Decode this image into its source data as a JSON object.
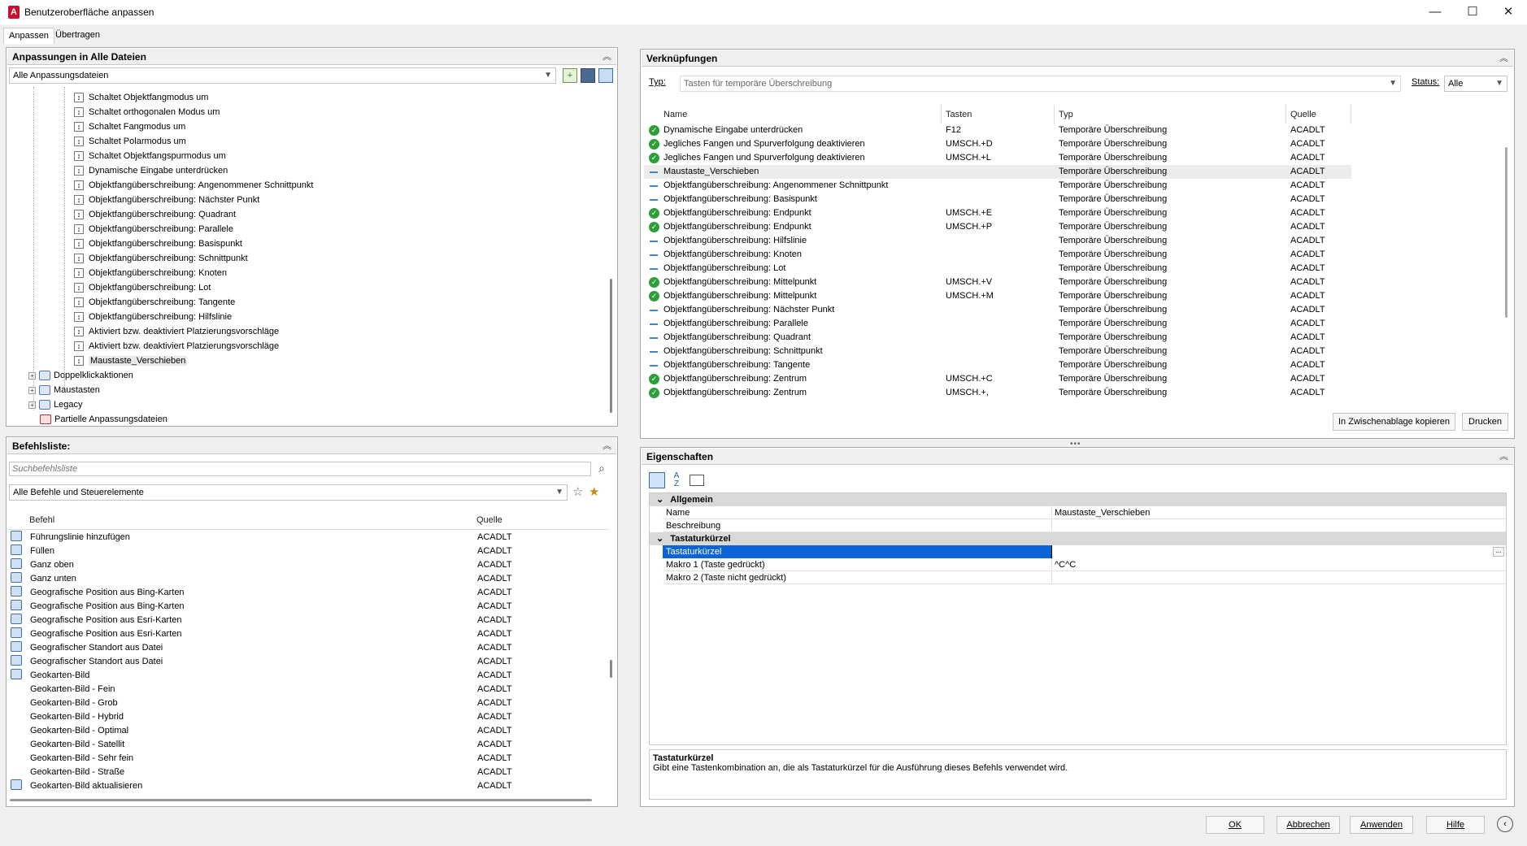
{
  "window": {
    "title": "Benutzeroberfläche anpassen",
    "app_icon": "A",
    "minimize": "—",
    "maximize": "☐",
    "close": "✕"
  },
  "tabs": [
    "Anpassen",
    "Übertragen"
  ],
  "customizations": {
    "title": "Anpassungen in Alle Dateien",
    "file_filter": "Alle Anpassungsdateien",
    "tree": [
      "Schaltet Objektfangmodus um",
      "Schaltet orthogonalen Modus um",
      "Schaltet Fangmodus um",
      "Schaltet Polarmodus um",
      "Schaltet Objektfangspurmodus um",
      "Dynamische Eingabe unterdrücken",
      "Objektfangüberschreibung: Angenommener Schnittpunkt",
      "Objektfangüberschreibung: Nächster Punkt",
      "Objektfangüberschreibung: Quadrant",
      "Objektfangüberschreibung: Parallele",
      "Objektfangüberschreibung: Basispunkt",
      "Objektfangüberschreibung: Schnittpunkt",
      "Objektfangüberschreibung: Knoten",
      "Objektfangüberschreibung: Lot",
      "Objektfangüberschreibung: Tangente",
      "Objektfangüberschreibung: Hilfslinie",
      "Aktiviert bzw. deaktiviert Platzierungsvorschläge",
      "Aktiviert bzw. deaktiviert Platzierungsvorschläge",
      "Maustaste_Verschieben"
    ],
    "folders": [
      "Doppelklickaktionen",
      "Maustasten",
      "Legacy",
      "Partielle Anpassungsdateien"
    ]
  },
  "commands": {
    "title": "Befehlsliste:",
    "search_placeholder": "Suchbefehlsliste",
    "filter": "Alle Befehle und Steuerelemente",
    "col_command": "Befehl",
    "col_source": "Quelle",
    "rows": [
      [
        "Führungslinie hinzufügen",
        "ACADLT"
      ],
      [
        "Füllen",
        "ACADLT"
      ],
      [
        "Ganz oben",
        "ACADLT"
      ],
      [
        "Ganz unten",
        "ACADLT"
      ],
      [
        "Geografische Position aus Bing-Karten",
        "ACADLT"
      ],
      [
        "Geografische Position aus Bing-Karten",
        "ACADLT"
      ],
      [
        "Geografische Position aus Esri-Karten",
        "ACADLT"
      ],
      [
        "Geografische Position aus Esri-Karten",
        "ACADLT"
      ],
      [
        "Geografischer Standort aus Datei",
        "ACADLT"
      ],
      [
        "Geografischer Standort aus Datei",
        "ACADLT"
      ],
      [
        "Geokarten-Bild",
        "ACADLT"
      ],
      [
        "Geokarten-Bild - Fein",
        "ACADLT"
      ],
      [
        "Geokarten-Bild - Grob",
        "ACADLT"
      ],
      [
        "Geokarten-Bild - Hybrid",
        "ACADLT"
      ],
      [
        "Geokarten-Bild - Optimal",
        "ACADLT"
      ],
      [
        "Geokarten-Bild - Satellit",
        "ACADLT"
      ],
      [
        "Geokarten-Bild - Sehr fein",
        "ACADLT"
      ],
      [
        "Geokarten-Bild - Straße",
        "ACADLT"
      ],
      [
        "Geokarten-Bild aktualisieren",
        "ACADLT"
      ]
    ]
  },
  "shortcuts": {
    "title": "Verknüpfungen",
    "type_label": "Typ:",
    "type_value": "Tasten für temporäre Überschreibung",
    "status_label": "Status:",
    "status_value": "Alle",
    "col_name": "Name",
    "col_keys": "Tasten",
    "col_type": "Typ",
    "col_source": "Quelle",
    "rows": [
      {
        "s": "ok",
        "name": "Dynamische Eingabe unterdrücken",
        "keys": "F12",
        "type": "Temporäre Überschreibung",
        "src": "ACADLT"
      },
      {
        "s": "ok",
        "name": "Jegliches Fangen und Spurverfolgung deaktivieren",
        "keys": "UMSCH.+D",
        "type": "Temporäre Überschreibung",
        "src": "ACADLT"
      },
      {
        "s": "ok",
        "name": "Jegliches Fangen und Spurverfolgung deaktivieren",
        "keys": "UMSCH.+L",
        "type": "Temporäre Überschreibung",
        "src": "ACADLT"
      },
      {
        "s": "dash",
        "name": "Maustaste_Verschieben",
        "keys": "",
        "type": "Temporäre Überschreibung",
        "src": "ACADLT"
      },
      {
        "s": "dash",
        "name": "Objektfangüberschreibung: Angenommener Schnittpunkt",
        "keys": "",
        "type": "Temporäre Überschreibung",
        "src": "ACADLT"
      },
      {
        "s": "dash",
        "name": "Objektfangüberschreibung: Basispunkt",
        "keys": "",
        "type": "Temporäre Überschreibung",
        "src": "ACADLT"
      },
      {
        "s": "ok",
        "name": "Objektfangüberschreibung: Endpunkt",
        "keys": "UMSCH.+E",
        "type": "Temporäre Überschreibung",
        "src": "ACADLT"
      },
      {
        "s": "ok",
        "name": "Objektfangüberschreibung: Endpunkt",
        "keys": "UMSCH.+P",
        "type": "Temporäre Überschreibung",
        "src": "ACADLT"
      },
      {
        "s": "dash",
        "name": "Objektfangüberschreibung: Hilfslinie",
        "keys": "",
        "type": "Temporäre Überschreibung",
        "src": "ACADLT"
      },
      {
        "s": "dash",
        "name": "Objektfangüberschreibung: Knoten",
        "keys": "",
        "type": "Temporäre Überschreibung",
        "src": "ACADLT"
      },
      {
        "s": "dash",
        "name": "Objektfangüberschreibung: Lot",
        "keys": "",
        "type": "Temporäre Überschreibung",
        "src": "ACADLT"
      },
      {
        "s": "ok",
        "name": "Objektfangüberschreibung: Mittelpunkt",
        "keys": "UMSCH.+V",
        "type": "Temporäre Überschreibung",
        "src": "ACADLT"
      },
      {
        "s": "ok",
        "name": "Objektfangüberschreibung: Mittelpunkt",
        "keys": "UMSCH.+M",
        "type": "Temporäre Überschreibung",
        "src": "ACADLT"
      },
      {
        "s": "dash",
        "name": "Objektfangüberschreibung: Nächster Punkt",
        "keys": "",
        "type": "Temporäre Überschreibung",
        "src": "ACADLT"
      },
      {
        "s": "dash",
        "name": "Objektfangüberschreibung: Parallele",
        "keys": "",
        "type": "Temporäre Überschreibung",
        "src": "ACADLT"
      },
      {
        "s": "dash",
        "name": "Objektfangüberschreibung: Quadrant",
        "keys": "",
        "type": "Temporäre Überschreibung",
        "src": "ACADLT"
      },
      {
        "s": "dash",
        "name": "Objektfangüberschreibung: Schnittpunkt",
        "keys": "",
        "type": "Temporäre Überschreibung",
        "src": "ACADLT"
      },
      {
        "s": "dash",
        "name": "Objektfangüberschreibung: Tangente",
        "keys": "",
        "type": "Temporäre Überschreibung",
        "src": "ACADLT"
      },
      {
        "s": "ok",
        "name": "Objektfangüberschreibung: Zentrum",
        "keys": "UMSCH.+C",
        "type": "Temporäre Überschreibung",
        "src": "ACADLT"
      },
      {
        "s": "ok",
        "name": "Objektfangüberschreibung: Zentrum",
        "keys": "UMSCH.+,",
        "type": "Temporäre Überschreibung",
        "src": "ACADLT"
      }
    ],
    "copy_button": "In Zwischenablage kopieren",
    "print_button": "Drucken"
  },
  "properties": {
    "title": "Eigenschaften",
    "cat_general": "Allgemein",
    "name_label": "Name",
    "name_value": "Maustaste_Verschieben",
    "desc_label": "Beschreibung",
    "desc_value": "",
    "cat_shortcut": "Tastaturkürzel",
    "shortcut_label": "Tastaturkürzel",
    "shortcut_value": "",
    "macro1_label": "Makro 1 (Taste gedrückt)",
    "macro1_value": "^C^C",
    "macro2_label": "Makro 2 (Taste nicht gedrückt)",
    "macro2_value": "",
    "ellipsis": "...",
    "help_title": "Tastaturkürzel",
    "help_text": "Gibt eine Tastenkombination an, die als Tastaturkürzel für die Ausführung dieses Befehls verwendet wird."
  },
  "footer": {
    "ok": "OK",
    "cancel": "Abbrechen",
    "apply": "Anwenden",
    "help": "Hilfe"
  }
}
